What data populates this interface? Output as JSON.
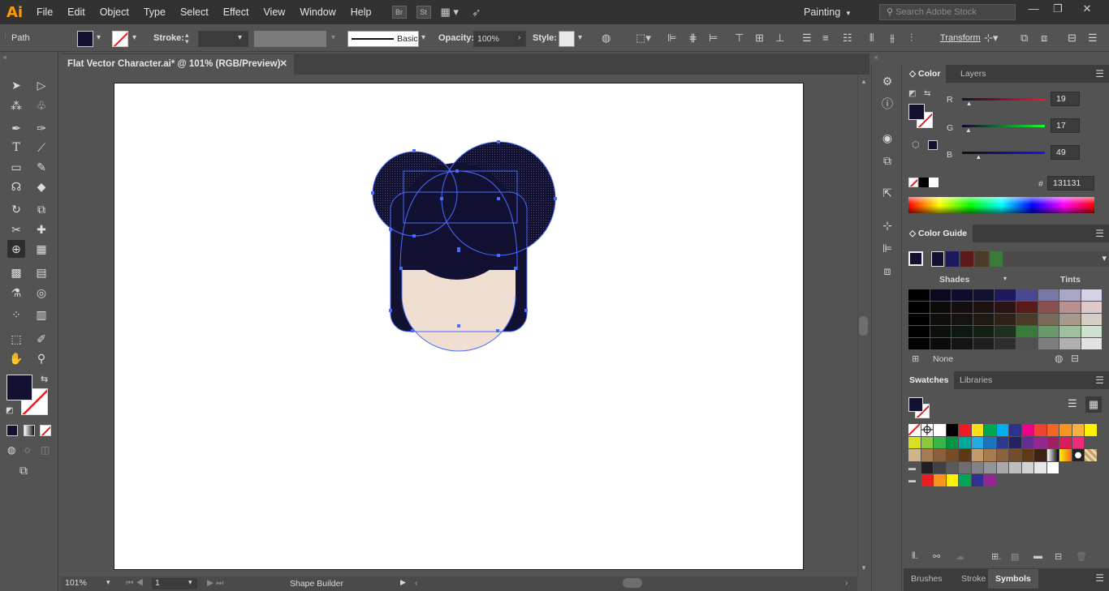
{
  "app": {
    "logo": "Ai",
    "menu": [
      "File",
      "Edit",
      "Object",
      "Type",
      "Select",
      "Effect",
      "View",
      "Window",
      "Help"
    ],
    "bridge_label": "Br",
    "stock_label": "St",
    "workspace": "Painting",
    "search_placeholder": "Search Adobe Stock"
  },
  "control_bar": {
    "selection_label": "Path",
    "stroke_label": "Stroke:",
    "brush_label": "Basic",
    "opacity_label": "Opacity:",
    "opacity_value": "100%",
    "style_label": "Style:",
    "transform_label": "Transform",
    "fill_color": "#131131"
  },
  "document": {
    "tab_title": "Flat Vector Character.ai* @ 101% (RGB/Preview)",
    "close_symbol": "✕"
  },
  "status_bar": {
    "zoom": "101%",
    "artboard_number": "1",
    "tool_name": "Shape Builder"
  },
  "color_panel": {
    "tabs": [
      "Color",
      "Layers"
    ],
    "channels": [
      {
        "label": "R",
        "value": "19",
        "fraction": 0.075
      },
      {
        "label": "G",
        "value": "17",
        "fraction": 0.067
      },
      {
        "label": "B",
        "value": "49",
        "fraction": 0.19
      }
    ],
    "hex_label": "#",
    "hex_value": "131131"
  },
  "color_guide_panel": {
    "tab": "Color Guide",
    "shades_label": "Shades",
    "tints_label": "Tints",
    "none_label": "None",
    "harmony_colors": [
      "#131131",
      "#1c1a5c",
      "#5a1a1a",
      "#4a3a28",
      "#3a7a3a"
    ]
  },
  "swatches_panel": {
    "tabs": [
      "Swatches",
      "Libraries"
    ]
  },
  "bottom_panel": {
    "tabs": [
      "Brushes",
      "Stroke",
      "Symbols"
    ]
  },
  "artwork": {
    "hair_color": "#131131",
    "skin_color": "#f0dfd0",
    "selection_color": "#4a6cff"
  }
}
